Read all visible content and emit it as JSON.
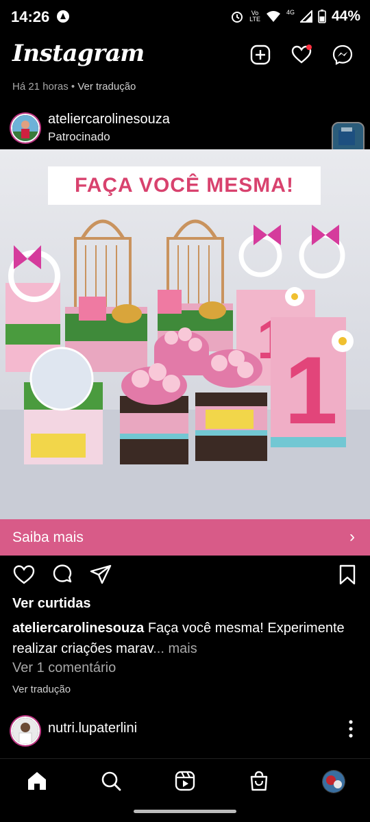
{
  "status_bar": {
    "time": "14:26",
    "battery": "44%",
    "net_top": "Vo",
    "net_bottom": "LTE",
    "net_4g": "4G"
  },
  "app_bar": {
    "logo": "Instagram",
    "icons": [
      "plus-square-icon",
      "heart-icon",
      "messenger-icon"
    ]
  },
  "post_meta": {
    "time_ago": "Há 21 horas",
    "separator": "•",
    "translate": "Ver tradução"
  },
  "post": {
    "author": "ateliercarolinesouza",
    "sponsored": "Patrocinado",
    "banner_text": "FAÇA VOCÊ MESMA!",
    "cta_label": "Saiba mais",
    "likes_text": "Ver curtidas",
    "caption_author": "ateliercarolinesouza",
    "caption_text": " Faça você mesma! Experimente realizar criações marav",
    "caption_more": "... mais",
    "comments_link": "Ver 1 comentário",
    "translate_link": "Ver tradução"
  },
  "next_post": {
    "author": "nutri.lupaterlini"
  },
  "bottom_nav": [
    "home-icon",
    "search-icon",
    "reels-icon",
    "shop-icon",
    "profile-avatar"
  ],
  "colors": {
    "accent_pink": "#d85b88",
    "banner_text": "#d8426e",
    "notification_dot": "#ff3040"
  }
}
